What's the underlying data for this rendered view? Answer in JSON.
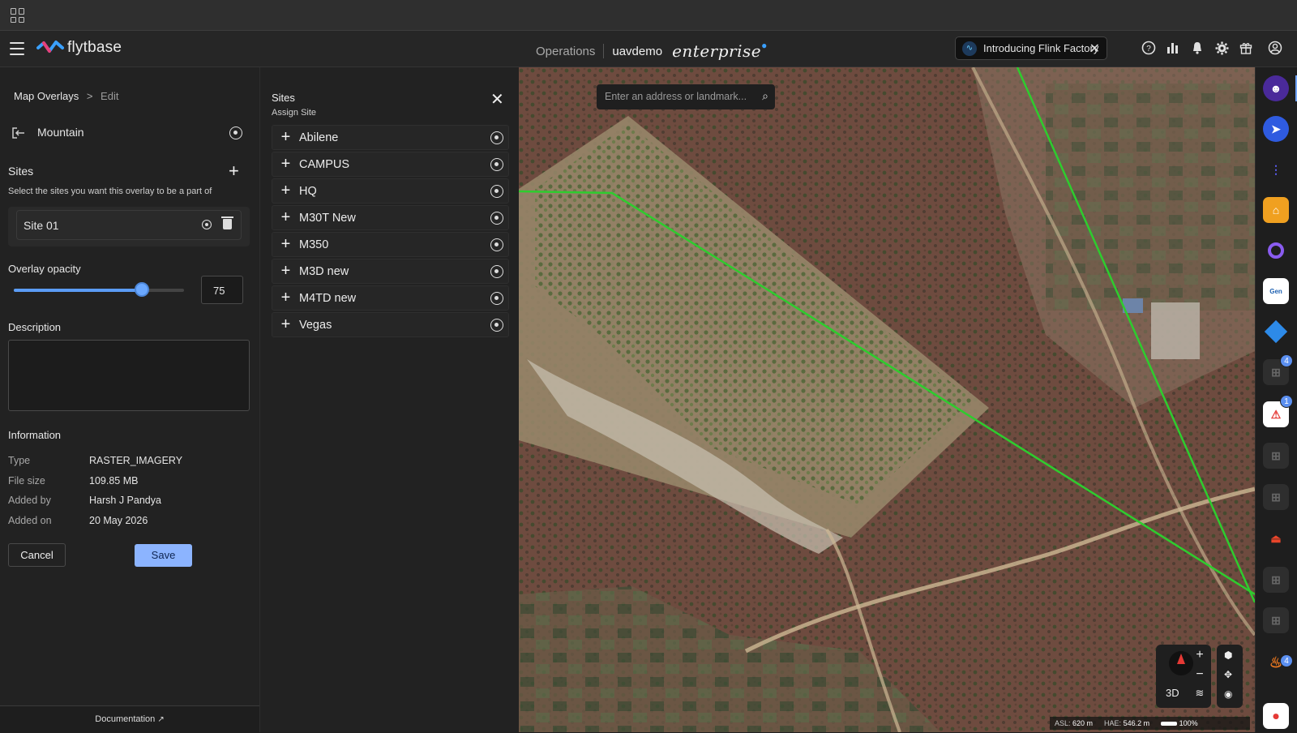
{
  "header": {
    "logo_text": "flytbase",
    "operations": "Operations",
    "org": "uavdemo",
    "edition": "enterprise",
    "promo_text": "Introducing Flink Factory"
  },
  "left_panel": {
    "breadcrumb_root": "Map Overlays",
    "breadcrumb_chevron": ">",
    "breadcrumb_current": "Edit",
    "overlay_name": "Mountain",
    "sites_heading": "Sites",
    "sites_subtitle": "Select the sites you want this overlay to be a part of",
    "assigned_site": "Site 01",
    "opacity_label": "Overlay opacity",
    "opacity_value": "75",
    "opacity_fraction": 0.75,
    "description_label": "Description",
    "description_value": "",
    "information_label": "Information",
    "info": [
      {
        "key": "Type",
        "value": "RASTER_IMAGERY"
      },
      {
        "key": "File size",
        "value": "109.85 MB"
      },
      {
        "key": "Added by",
        "value": "Harsh J Pandya"
      },
      {
        "key": "Added on",
        "value": "20 May 2026"
      }
    ],
    "cancel_label": "Cancel",
    "save_label": "Save",
    "documentation_label": "Documentation"
  },
  "sites_panel": {
    "title": "Sites",
    "subtitle": "Assign Site",
    "sites": [
      "Abilene",
      "CAMPUS",
      "HQ",
      "M30T New",
      "M350",
      "M3D new",
      "M4TD new",
      "Vegas"
    ]
  },
  "map": {
    "search_placeholder": "Enter an address or landmark...",
    "mode_label": "3D",
    "asl_label": "ASL:",
    "asl_value": "620 m",
    "hae_label": "HAE:",
    "hae_value": "546.2 m",
    "zoom_percent": "100%"
  },
  "right_rail": {
    "badges": {
      "item8": "4",
      "item9": "1",
      "item15": "4"
    }
  },
  "colors": {
    "accent": "#8cb4ff",
    "slider": "#5b9cf5",
    "flight_line": "#2ecc2e"
  }
}
